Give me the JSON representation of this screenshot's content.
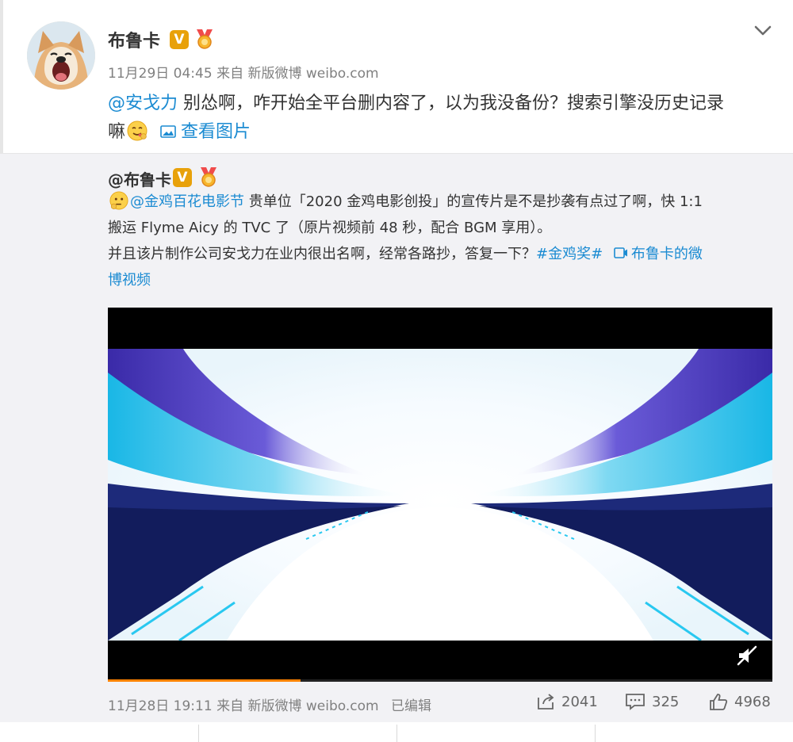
{
  "post": {
    "author": {
      "name": "布鲁卡",
      "verified_badge": "V",
      "avatar_icon": "shiba-dog-avatar",
      "medal_icon": "fan-medal-icon"
    },
    "meta": {
      "date": "11月29日 04:45",
      "source_prefix": "来自",
      "source": "新版微博 weibo.com"
    },
    "content": {
      "mention": "@安戈力",
      "text_line1": " 别怂啊，咋开始全平台删内容了，以为我没备份？搜索引擎没历史记录",
      "text_line2": "嘛",
      "emoji_icon": "yummy-face-emoji",
      "view_pictures": "查看图片"
    }
  },
  "repost": {
    "author_name": "@布鲁卡",
    "verified_badge": "V",
    "mention": "@金鸡百花电影节",
    "text1": " 贵单位「2020 金鸡电影创投」的宣传片是不是抄袭有点过了啊，快 1:1",
    "text2": "搬运 Flyme Aicy 的 TVC 了（原片视频前 48 秒，配合 BGM 享用）。",
    "text3": "并且该片制作公司安戈力在业内很出名啊，经常各路抄，答复一下？",
    "hashtag": "#金鸡奖#",
    "video_link_1": "布鲁卡的微",
    "video_link_2": "博视频",
    "video": {
      "progress": 0.29,
      "mute_icon": "muted-speaker-icon"
    },
    "footer": {
      "date": "11月28日 19:11",
      "source_prefix": "来自",
      "source": "新版微博 weibo.com",
      "edited": "已编辑",
      "reposts": "2041",
      "comments": "325",
      "likes": "4968"
    }
  },
  "colors": {
    "link_blue": "#1b8bd2",
    "mention_orange": "#eb7350",
    "badge_gold": "#e8a10a",
    "panel_bg": "#f2f2f5",
    "progress_orange": "#ff8200"
  }
}
